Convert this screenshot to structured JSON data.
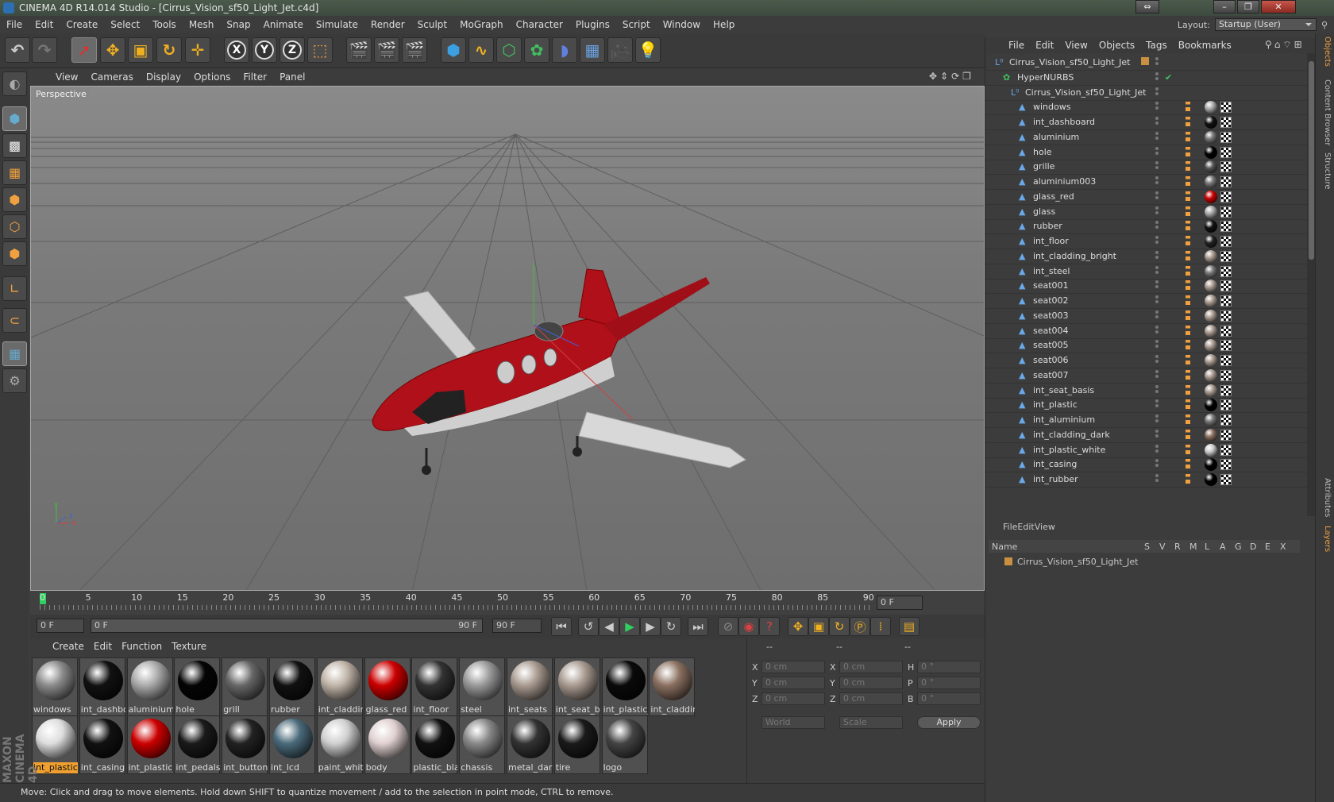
{
  "title": "CINEMA 4D R14.014 Studio - [Cirrus_Vision_sf50_Light_Jet.c4d]",
  "menu": [
    "File",
    "Edit",
    "Create",
    "Select",
    "Tools",
    "Mesh",
    "Snap",
    "Animate",
    "Simulate",
    "Render",
    "Sculpt",
    "MoGraph",
    "Character",
    "Plugins",
    "Script",
    "Window",
    "Help"
  ],
  "layout": {
    "label": "Layout:",
    "value": "Startup (User)"
  },
  "viewport": {
    "menu": [
      "View",
      "Cameras",
      "Display",
      "Options",
      "Filter",
      "Panel"
    ],
    "label": "Perspective",
    "axis_x": "x",
    "axis_y": "y",
    "axis_z": "z"
  },
  "timeline": {
    "ticks": [
      "0",
      "5",
      "10",
      "15",
      "20",
      "25",
      "30",
      "35",
      "40",
      "45",
      "50",
      "55",
      "60",
      "65",
      "70",
      "75",
      "80",
      "85",
      "90"
    ],
    "current": "0 F",
    "start": "0 F",
    "slider_start": "0 F",
    "slider_end": "90 F",
    "end": "90 F"
  },
  "materials": {
    "menu": [
      "Create",
      "Edit",
      "Function",
      "Texture"
    ],
    "row1": [
      {
        "n": "windows",
        "c": "#8a8a8a"
      },
      {
        "n": "int_dashbo",
        "c": "#111"
      },
      {
        "n": "aluminium",
        "c": "#aaa"
      },
      {
        "n": "hole",
        "c": "#050505"
      },
      {
        "n": "grill",
        "c": "#666"
      },
      {
        "n": "rubber",
        "c": "#111"
      },
      {
        "n": "int_claddin",
        "c": "#c0b4a8"
      },
      {
        "n": "glass_red",
        "c": "#cc0000"
      },
      {
        "n": "int_floor",
        "c": "#333"
      },
      {
        "n": "steel",
        "c": "#999"
      },
      {
        "n": "int_seats",
        "c": "#a89a90"
      },
      {
        "n": "int_seat_ba",
        "c": "#a89a90"
      },
      {
        "n": "int_plastic_",
        "c": "#0a0a0a"
      },
      {
        "n": "int_claddin",
        "c": "#8a7060"
      }
    ],
    "row2": [
      {
        "n": "int_plastic",
        "c": "#ddd",
        "sel": true
      },
      {
        "n": "int_casing",
        "c": "#111"
      },
      {
        "n": "int_plastic_",
        "c": "#cc0000"
      },
      {
        "n": "int_pedals",
        "c": "#1a1a1a"
      },
      {
        "n": "int_button",
        "c": "#222"
      },
      {
        "n": "int_lcd",
        "c": "#4a6a7a"
      },
      {
        "n": "paint_whit",
        "c": "#d0d0d0"
      },
      {
        "n": "body",
        "c": "#e0d0d0"
      },
      {
        "n": "plastic_bla",
        "c": "#111"
      },
      {
        "n": "chassis",
        "c": "#888"
      },
      {
        "n": "metal_dark",
        "c": "#333"
      },
      {
        "n": "tire",
        "c": "#1a1a1a"
      },
      {
        "n": "logo",
        "c": "#444"
      }
    ]
  },
  "coords": {
    "head1": "--",
    "head2": "--",
    "head3": "--",
    "x": "X",
    "y": "Y",
    "z": "Z",
    "h": "H",
    "p": "P",
    "b": "B",
    "x1": "0 cm",
    "y1": "0 cm",
    "z1": "0 cm",
    "x2": "0 cm",
    "y2": "0 cm",
    "z2": "0 cm",
    "hv": "0 °",
    "pv": "0 °",
    "bv": "0 °",
    "world": "World",
    "scale": "Scale",
    "apply": "Apply"
  },
  "objects": {
    "menu": [
      "File",
      "Edit",
      "View",
      "Objects",
      "Tags",
      "Bookmarks"
    ],
    "items": [
      {
        "n": "Cirrus_Vision_sf50_Light_Jet",
        "ind": 0,
        "kind": "null"
      },
      {
        "n": "HyperNURBS",
        "ind": 1,
        "kind": "nurbs"
      },
      {
        "n": "Cirrus_Vision_sf50_Light_Jet",
        "ind": 2,
        "kind": "null"
      },
      {
        "n": "windows",
        "ind": 3,
        "t": "#aaa"
      },
      {
        "n": "int_dashboard",
        "ind": 3,
        "t": "#111"
      },
      {
        "n": "aluminium",
        "ind": 3,
        "t": "#777"
      },
      {
        "n": "hole",
        "ind": 3,
        "t": "#000"
      },
      {
        "n": "grille",
        "ind": 3,
        "t": "#555"
      },
      {
        "n": "aluminium003",
        "ind": 3,
        "t": "#777"
      },
      {
        "n": "glass_red",
        "ind": 3,
        "t": "#cc0000"
      },
      {
        "n": "glass",
        "ind": 3,
        "t": "#aaa"
      },
      {
        "n": "rubber",
        "ind": 3,
        "t": "#111"
      },
      {
        "n": "int_floor",
        "ind": 3,
        "t": "#222"
      },
      {
        "n": "int_cladding_bright",
        "ind": 3,
        "t": "#a89a90"
      },
      {
        "n": "int_steel",
        "ind": 3,
        "t": "#777"
      },
      {
        "n": "seat001",
        "ind": 3,
        "t": "#a89a90"
      },
      {
        "n": "seat002",
        "ind": 3,
        "t": "#a89a90"
      },
      {
        "n": "seat003",
        "ind": 3,
        "t": "#a89a90"
      },
      {
        "n": "seat004",
        "ind": 3,
        "t": "#a89a90"
      },
      {
        "n": "seat005",
        "ind": 3,
        "t": "#a89a90"
      },
      {
        "n": "seat006",
        "ind": 3,
        "t": "#a89a90"
      },
      {
        "n": "seat007",
        "ind": 3,
        "t": "#a89a90"
      },
      {
        "n": "int_seat_basis",
        "ind": 3,
        "t": "#a89a90"
      },
      {
        "n": "int_plastic",
        "ind": 3,
        "t": "#000"
      },
      {
        "n": "int_aluminium",
        "ind": 3,
        "t": "#777"
      },
      {
        "n": "int_cladding_dark",
        "ind": 3,
        "t": "#8a7060"
      },
      {
        "n": "int_plastic_white",
        "ind": 3,
        "t": "#ccc"
      },
      {
        "n": "int_casing",
        "ind": 3,
        "t": "#000"
      },
      {
        "n": "int_rubber",
        "ind": 3,
        "t": "#000"
      }
    ]
  },
  "layers": {
    "menu": [
      "File",
      "Edit",
      "View"
    ],
    "cols": [
      "Name",
      "S",
      "V",
      "R",
      "M",
      "L",
      "A",
      "G",
      "D",
      "E",
      "X"
    ],
    "row": "Cirrus_Vision_sf50_Light_Jet"
  },
  "sidetabs": [
    "Objects",
    "Content Browser",
    "Structure",
    "Attributes",
    "Layers"
  ],
  "status": "Move: Click and drag to move elements. Hold down SHIFT to quantize movement / add to the selection in point mode, CTRL to remove.",
  "brand": {
    "a": "MAXON",
    "b": "CINEMA 4D"
  }
}
